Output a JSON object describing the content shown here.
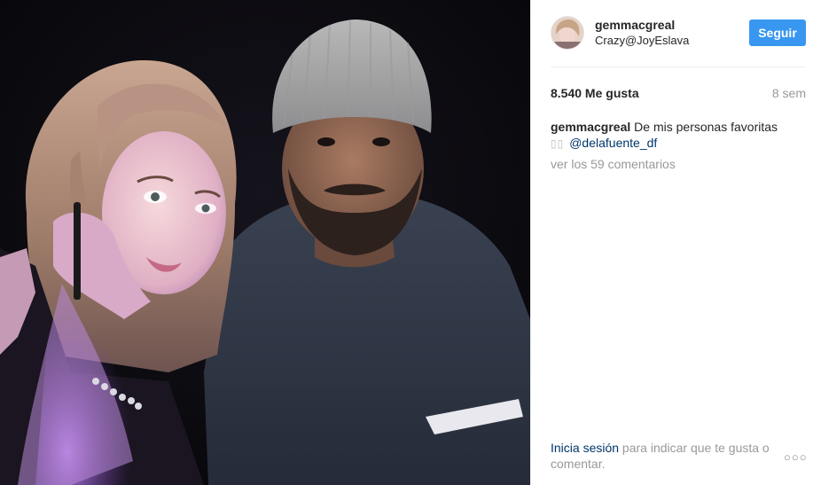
{
  "post": {
    "username": "gemmacgreal",
    "location": "Crazy@JoyEslava",
    "follow_label": "Seguir",
    "likes": "8.540 Me gusta",
    "time_ago": "8 sem",
    "caption_user": "gemmacgreal",
    "caption_text": "De mis personas favoritas",
    "caption_emoji": "▯▯",
    "caption_mention": "@delafuente_df",
    "comments_link": "ver los 59 comentarios",
    "login_link": "Inicia sesión",
    "login_text": " para indicar que te gusta o comentar.",
    "more_icon": "more-options-icon"
  },
  "colors": {
    "accent": "#3897f0",
    "link": "#003569",
    "muted": "#999999",
    "text": "#262626"
  }
}
